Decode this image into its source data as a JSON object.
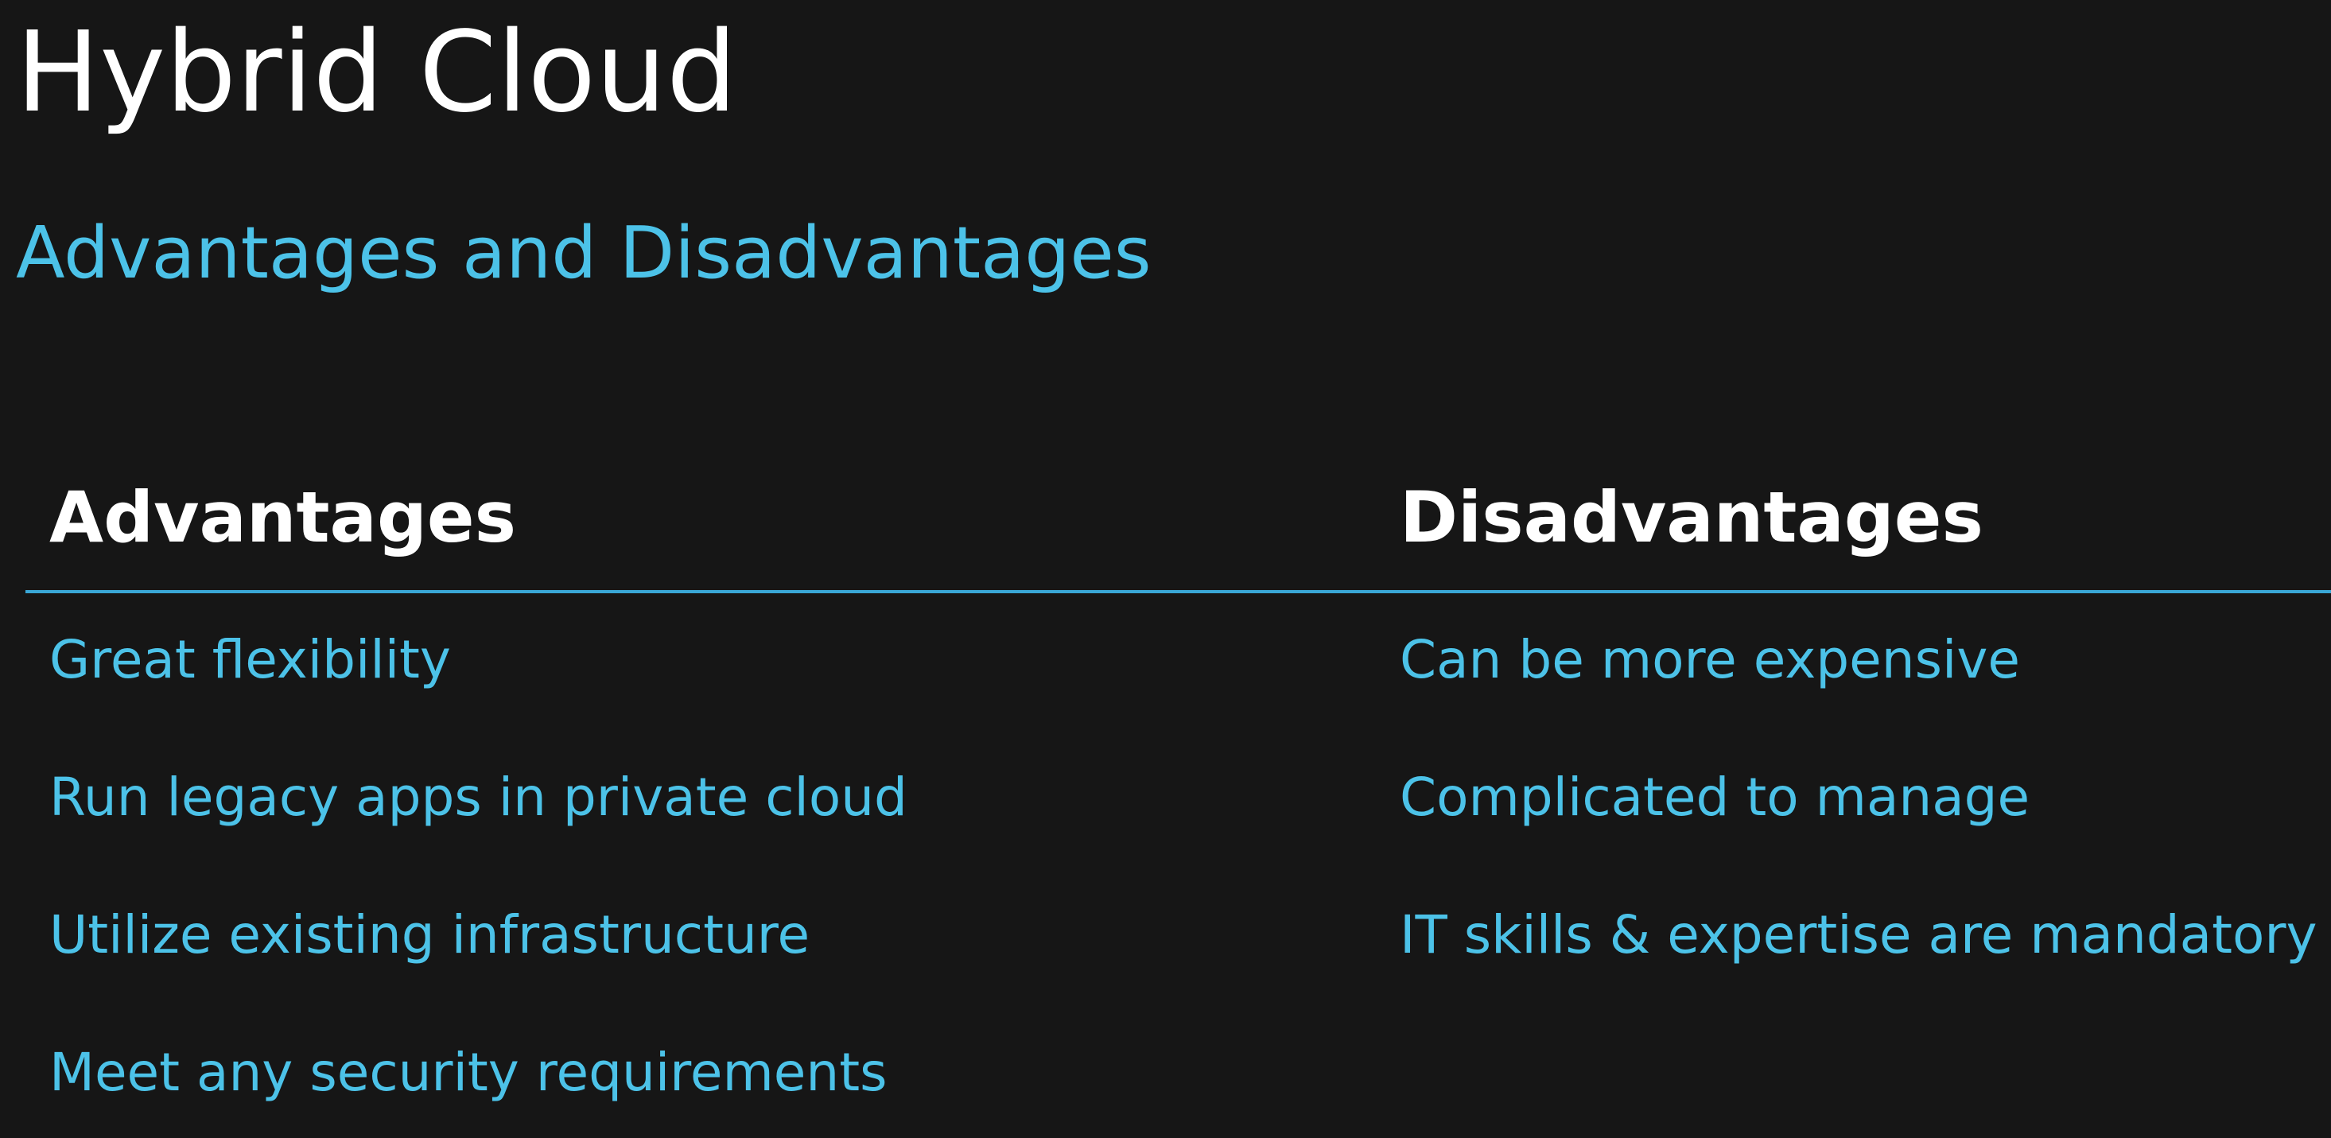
{
  "slide": {
    "title": "Hybrid Cloud",
    "subtitle": "Advantages and Disadvantages",
    "advantages_header": "Advantages",
    "disadvantages_header": "Disadvantages",
    "advantages": [
      "Great flexibility",
      "Run legacy apps in private cloud",
      "Utilize existing infrastructure",
      "Meet any security requirements"
    ],
    "disadvantages": [
      "Can be more expensive",
      "Complicated to manage",
      "IT skills & expertise are mandatory"
    ]
  },
  "colors": {
    "background": "#161616",
    "accent": "#4cc2e8",
    "heading": "#ffffff",
    "divider": "#3aa7d6"
  }
}
